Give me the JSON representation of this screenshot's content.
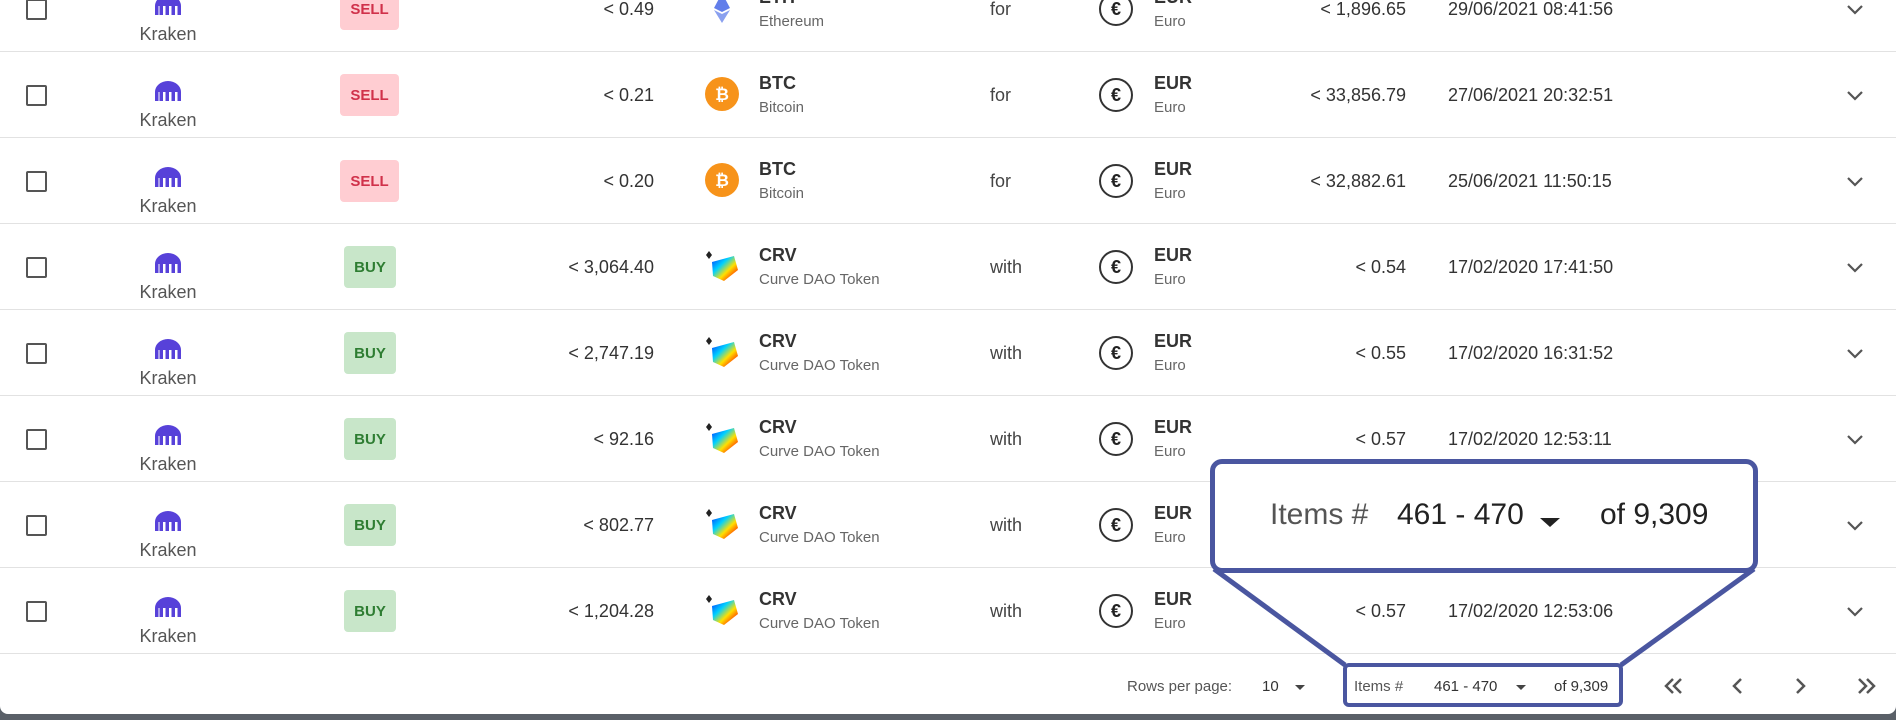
{
  "rows": [
    {
      "exchange": "Kraken",
      "type": "SELL",
      "amount": "< 0.49",
      "symbol": "ETH",
      "coin": "Ethereum",
      "conj": "for",
      "fiat_symbol": "EUR",
      "fiat_name": "Euro",
      "price": "< 1,896.65",
      "date": "29/06/2021 08:41:56"
    },
    {
      "exchange": "Kraken",
      "type": "SELL",
      "amount": "< 0.21",
      "symbol": "BTC",
      "coin": "Bitcoin",
      "conj": "for",
      "fiat_symbol": "EUR",
      "fiat_name": "Euro",
      "price": "< 33,856.79",
      "date": "27/06/2021 20:32:51"
    },
    {
      "exchange": "Kraken",
      "type": "SELL",
      "amount": "< 0.20",
      "symbol": "BTC",
      "coin": "Bitcoin",
      "conj": "for",
      "fiat_symbol": "EUR",
      "fiat_name": "Euro",
      "price": "< 32,882.61",
      "date": "25/06/2021 11:50:15"
    },
    {
      "exchange": "Kraken",
      "type": "BUY",
      "amount": "< 3,064.40",
      "symbol": "CRV",
      "coin": "Curve DAO Token",
      "conj": "with",
      "fiat_symbol": "EUR",
      "fiat_name": "Euro",
      "price": "< 0.54",
      "date": "17/02/2020 17:41:50"
    },
    {
      "exchange": "Kraken",
      "type": "BUY",
      "amount": "< 2,747.19",
      "symbol": "CRV",
      "coin": "Curve DAO Token",
      "conj": "with",
      "fiat_symbol": "EUR",
      "fiat_name": "Euro",
      "price": "< 0.55",
      "date": "17/02/2020 16:31:52"
    },
    {
      "exchange": "Kraken",
      "type": "BUY",
      "amount": "< 92.16",
      "symbol": "CRV",
      "coin": "Curve DAO Token",
      "conj": "with",
      "fiat_symbol": "EUR",
      "fiat_name": "Euro",
      "price": "< 0.57",
      "date": "17/02/2020 12:53:11"
    },
    {
      "exchange": "Kraken",
      "type": "BUY",
      "amount": "< 802.77",
      "symbol": "CRV",
      "coin": "Curve DAO Token",
      "conj": "with",
      "fiat_symbol": "EUR",
      "fiat_name": "Euro",
      "price": "",
      "date": ""
    },
    {
      "exchange": "Kraken",
      "type": "BUY",
      "amount": "< 1,204.28",
      "symbol": "CRV",
      "coin": "Curve DAO Token",
      "conj": "with",
      "fiat_symbol": "EUR",
      "fiat_name": "Euro",
      "price": "< 0.57",
      "date": "17/02/2020 12:53:06"
    }
  ],
  "footer": {
    "rows_per_page_label": "Rows per page:",
    "rows_per_page_value": "10",
    "items_label": "Items #",
    "items_range": "461 - 470",
    "items_total": "of 9,309"
  },
  "zoom": {
    "items_label": "Items #",
    "items_range": "461 - 470",
    "items_total": "of 9,309"
  },
  "colors": {
    "accent": "#4a56a0",
    "kraken": "#5741d9",
    "sell_bg": "#ffcdd2",
    "sell_text": "#d0314a",
    "buy_bg": "#c8e6c9",
    "buy_text": "#2e7d32",
    "btc": "#f7931a"
  },
  "icons": {
    "exchange": "kraken-logo-icon",
    "eur": "euro-icon",
    "expand": "chevron-down-icon",
    "first": "first-page-icon",
    "prev": "prev-page-icon",
    "next": "next-page-icon",
    "last": "last-page-icon"
  }
}
